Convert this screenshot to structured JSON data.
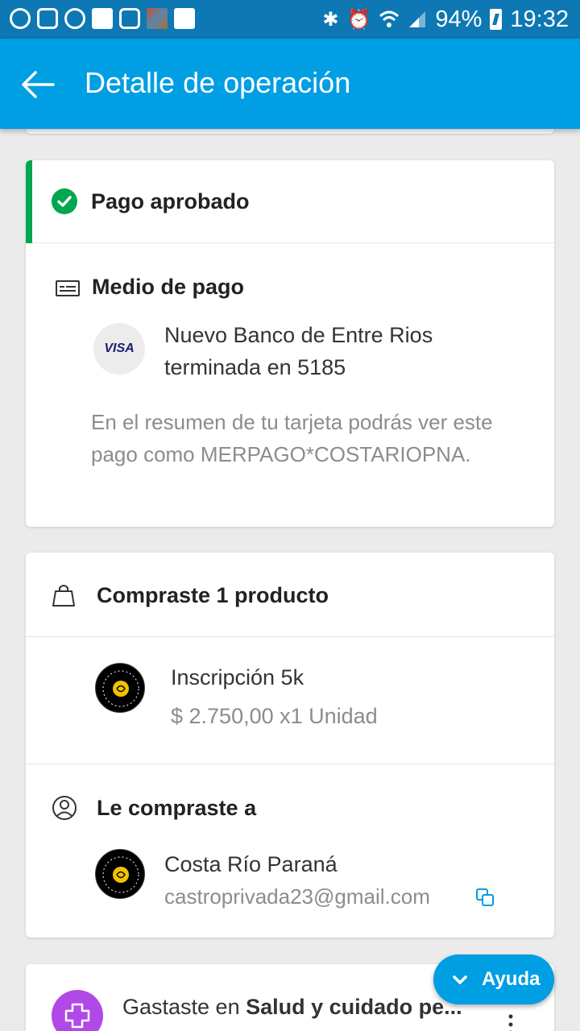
{
  "status_bar": {
    "battery": "94%",
    "time": "19:32",
    "icons": [
      "sync-icon",
      "instagram-icon",
      "messenger-icon",
      "flipboard-icon",
      "sim-icon",
      "photo-icon",
      "voicemail-icon",
      "bluetooth-icon",
      "alarm-icon",
      "wifi-icon",
      "signal-icon",
      "battery-icon"
    ]
  },
  "app_bar": {
    "back_icon": "arrow-left-icon",
    "title": "Detalle de operación"
  },
  "payment_status": {
    "label": "Pago aprobado",
    "color": "#00a650"
  },
  "payment_method": {
    "title": "Medio de pago",
    "card_brand": "VISA",
    "bank_line1": "Nuevo Banco de Entre Rios",
    "bank_line2": "terminada en 5185",
    "statement_note": "En el resumen de tu tarjeta podrás ver este pago como MERPAGO*COSTARIOPNA."
  },
  "purchase": {
    "title": "Compraste 1 producto",
    "product_name": "Inscripción 5k",
    "product_price": "$ 2.750,00 x1 Unidad"
  },
  "seller": {
    "title": "Le compraste a",
    "name": "Costa Río Paraná",
    "email": "castroprivada23@gmail.com"
  },
  "spending": {
    "prefix": "Gastaste en ",
    "category": "Salud y cuidado pe..."
  },
  "help_button": {
    "label": "Ayuda"
  },
  "colors": {
    "app_bar": "#009ee3",
    "status_bar": "#0d78b3",
    "approved": "#00a650",
    "category": "#b148e8"
  }
}
